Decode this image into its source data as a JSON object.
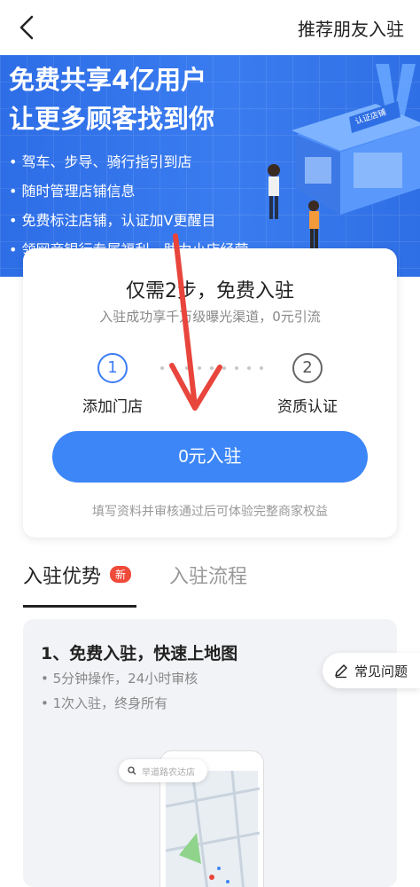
{
  "header": {
    "right_link": "推荐朋友入驻"
  },
  "banner": {
    "title_line1": "免费共享4亿用户",
    "title_line2": "让更多顾客找到你",
    "bullets": [
      "驾车、步导、骑行指引到店",
      "随时管理店铺信息",
      "免费标注店铺，认证加V更醒目",
      "领网商银行专属福利，助力小店经营"
    ],
    "storefront_label": "认证店铺"
  },
  "card": {
    "title": "仅需2步，免费入驻",
    "subtitle": "入驻成功享千万级曝光渠道，0元引流",
    "steps": [
      {
        "number": "1",
        "label": "添加门店"
      },
      {
        "number": "2",
        "label": "资质认证"
      }
    ],
    "cta": "0元入驻",
    "note": "填写资料并审核通过后可体验完整商家权益"
  },
  "tabs": [
    {
      "label": "入驻优势",
      "badge": "新"
    },
    {
      "label": "入驻流程"
    }
  ],
  "panel": {
    "title": "1、免费入驻，快速上地图",
    "lines": [
      "5分钟操作，24小时审核",
      "1次入驻，终身所有"
    ],
    "search_placeholder": "早道路农达店"
  },
  "faq": {
    "label": "常见问题"
  },
  "colors": {
    "accent": "#3d86f7",
    "banner_blue": "#2d6de6",
    "annotation_red": "#e8453c",
    "badge_red": "#f04a3a"
  }
}
